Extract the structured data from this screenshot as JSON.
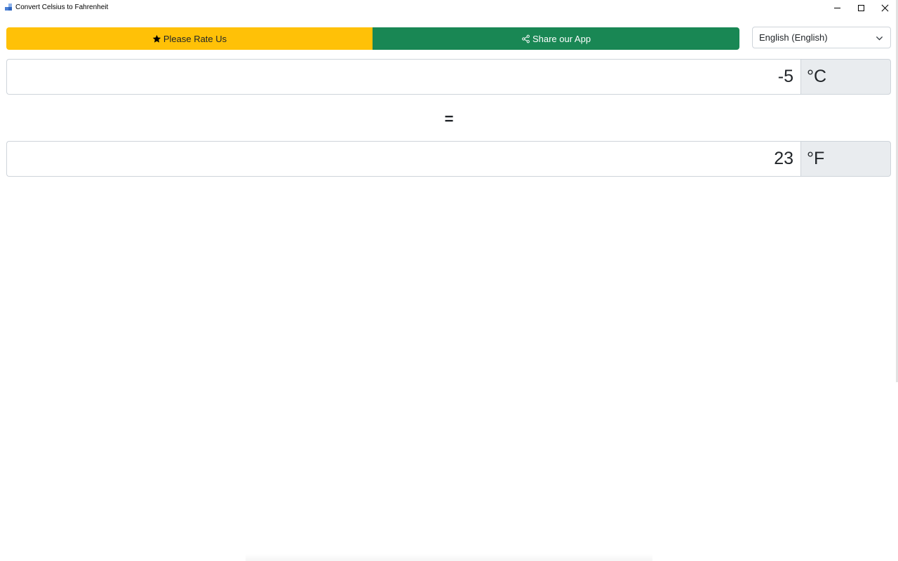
{
  "window": {
    "title": "Convert Celsius to Fahrenheit"
  },
  "toolbar": {
    "rate_label": "Please Rate Us",
    "share_label": "Share our App",
    "rate_color": "#ffc107",
    "share_color": "#198754"
  },
  "language": {
    "selected": "English (English)"
  },
  "converter": {
    "celsius_value": "-5",
    "celsius_unit": "°C",
    "equals": "=",
    "fahrenheit_value": "23",
    "fahrenheit_unit": "°F"
  },
  "icons": {
    "rate": "star-icon",
    "share": "share-icon",
    "dropdown": "chevron-down-icon"
  }
}
